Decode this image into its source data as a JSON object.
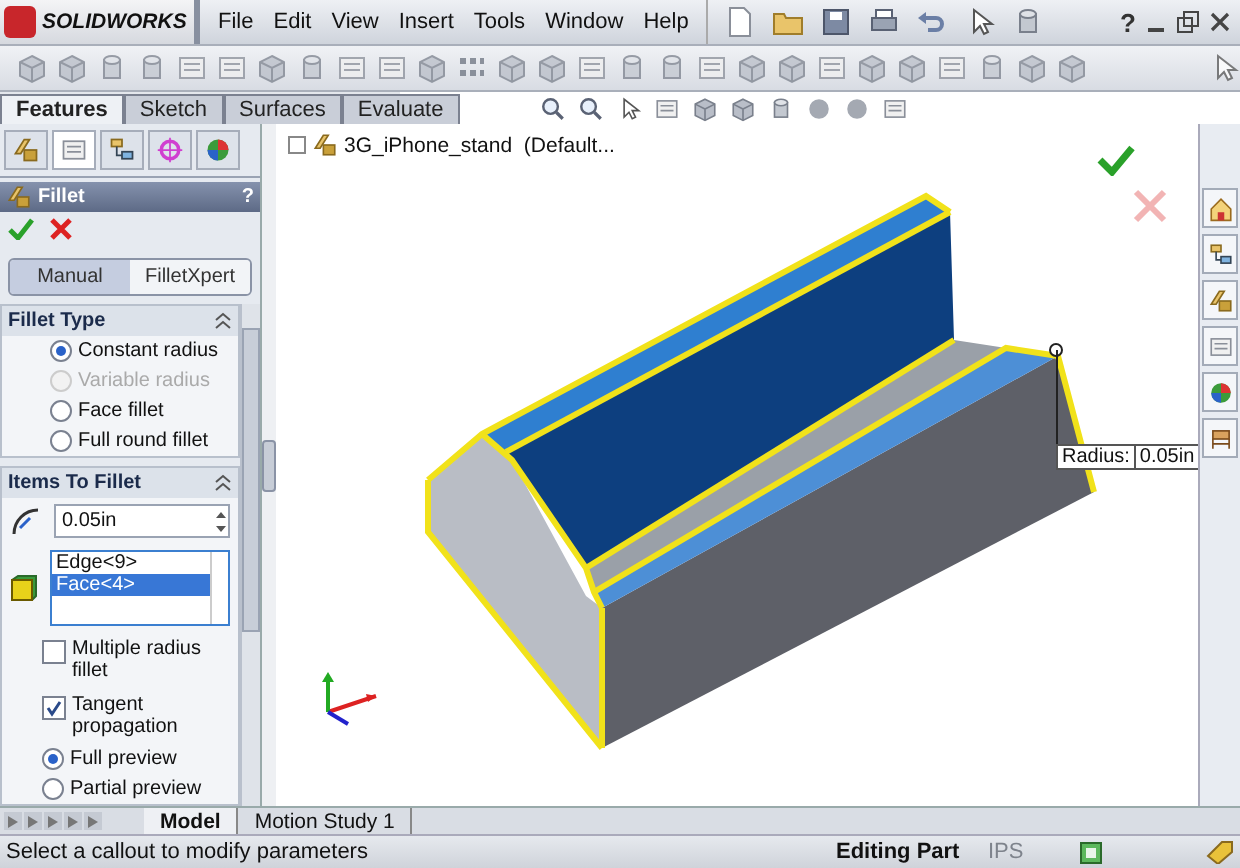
{
  "title_bar": {
    "app_name": "SOLIDWORKS",
    "menu": [
      "File",
      "Edit",
      "View",
      "Insert",
      "Tools",
      "Window",
      "Help"
    ],
    "help": "?"
  },
  "command_tabs": [
    {
      "label": "Features",
      "selected": true
    },
    {
      "label": "Sketch",
      "selected": false
    },
    {
      "label": "Surfaces",
      "selected": false
    },
    {
      "label": "Evaluate",
      "selected": false
    }
  ],
  "property_manager": {
    "title": "Fillet",
    "help": "?",
    "mode_tabs": [
      {
        "label": "Manual",
        "selected": true
      },
      {
        "label": "FilletXpert",
        "selected": false
      }
    ],
    "fillet_type": {
      "title": "Fillet Type",
      "options": [
        {
          "label": "Constant radius",
          "selected": true,
          "disabled": false
        },
        {
          "label": "Variable radius",
          "selected": false,
          "disabled": true
        },
        {
          "label": "Face fillet",
          "selected": false,
          "disabled": false
        },
        {
          "label": "Full round fillet",
          "selected": false,
          "disabled": false
        }
      ]
    },
    "items_to_fillet": {
      "title": "Items To Fillet",
      "radius": "0.05in",
      "selection": [
        {
          "label": "Edge<9>",
          "selected": false
        },
        {
          "label": "Face<4>",
          "selected": true
        }
      ],
      "checkboxes": [
        {
          "label": "Multiple radius fillet",
          "checked": false
        },
        {
          "label": "Tangent propagation",
          "checked": true
        }
      ],
      "preview": [
        {
          "label": "Full preview",
          "selected": true
        },
        {
          "label": "Partial preview",
          "selected": false
        }
      ]
    }
  },
  "viewport": {
    "tree_item": "3G_iPhone_stand  (Default...",
    "callout": {
      "label": "Radius:",
      "value": "0.05in"
    }
  },
  "bottom_tabs": [
    {
      "label": "Model",
      "selected": true
    },
    {
      "label": "Motion Study 1",
      "selected": false
    }
  ],
  "status_bar": {
    "message": "Select a callout to modify parameters",
    "mode": "Editing Part",
    "units": "IPS"
  }
}
